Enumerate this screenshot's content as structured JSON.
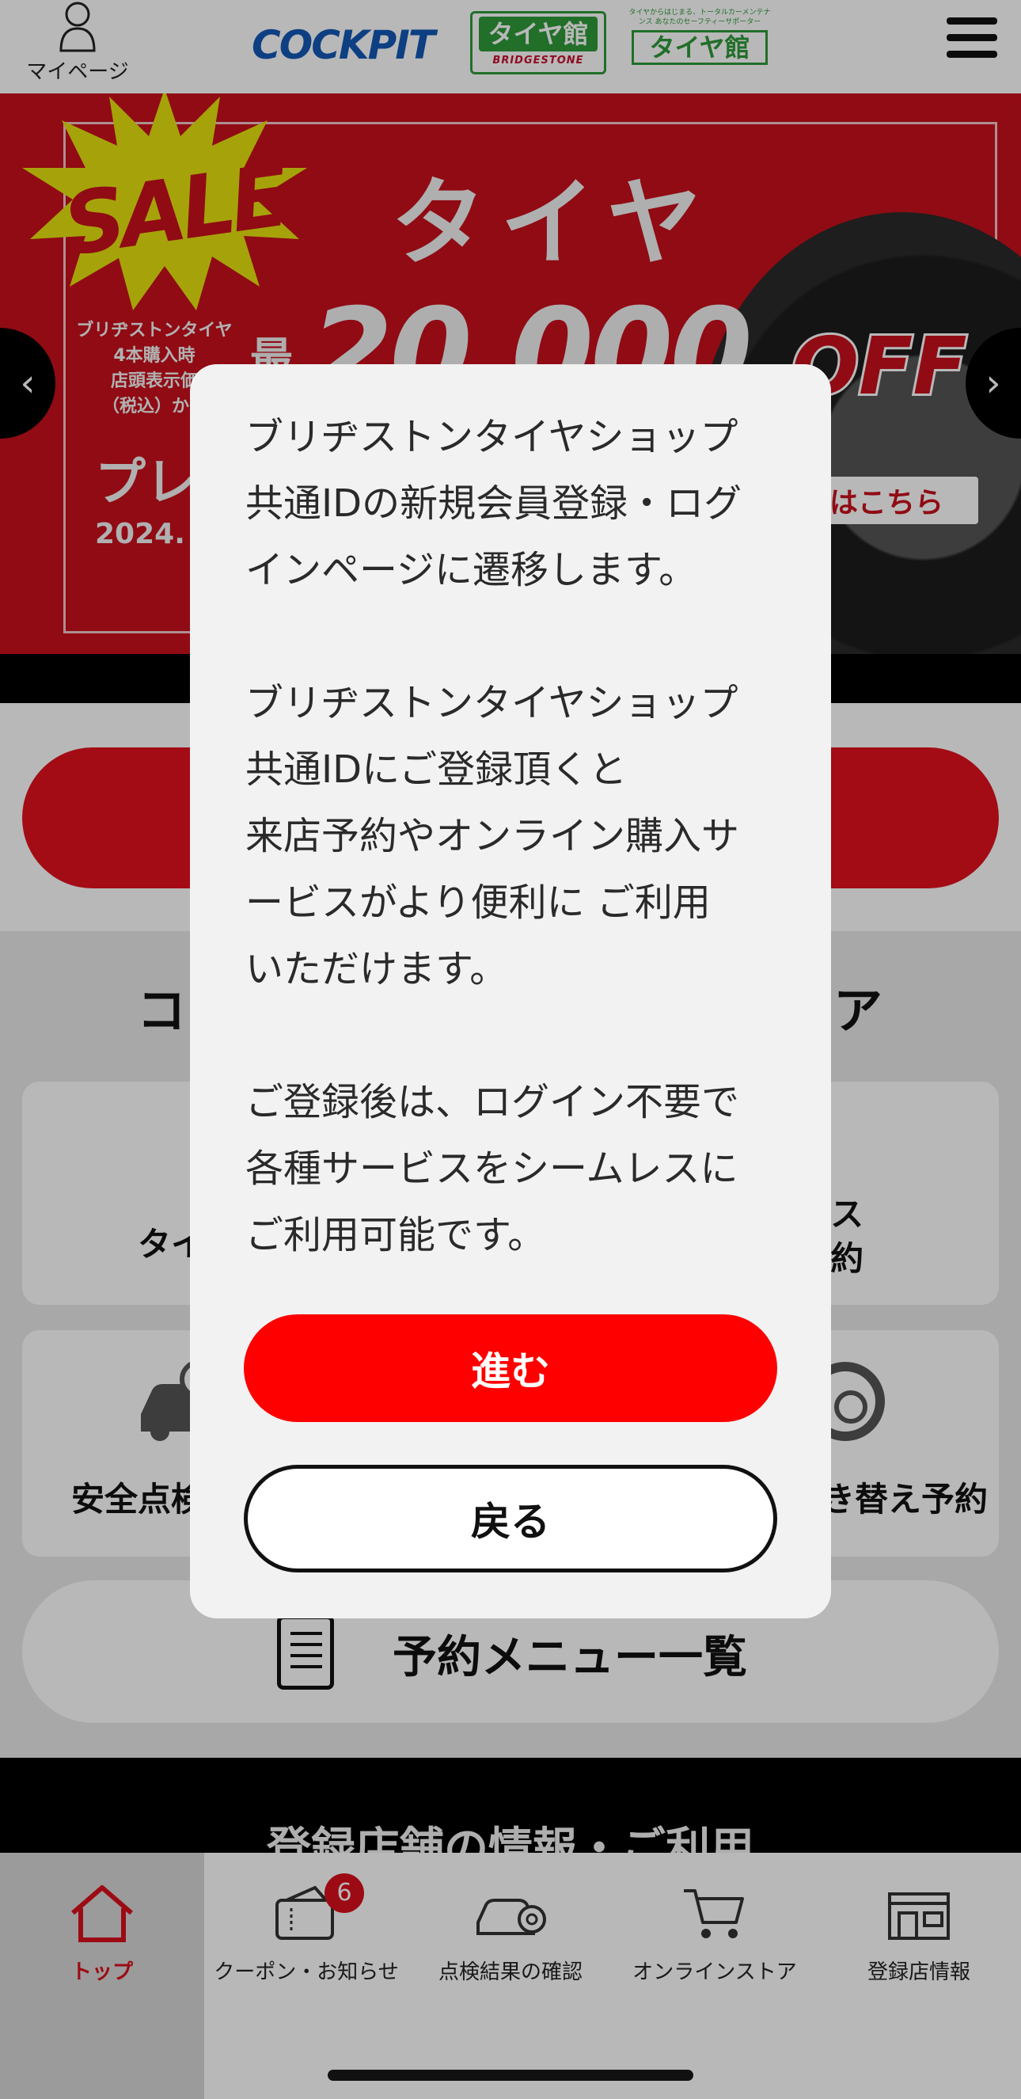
{
  "header": {
    "mypage_label": "マイページ",
    "logo_cockpit": "COCKPIT",
    "logo_tire1_main": "タイヤ館",
    "logo_tire1_brand": "BRIDGESTONE",
    "logo_tire2_small": "タイヤからはじまる、トータルカーメンテナンス あなたのセーフティーサポーター",
    "logo_tire2_main": "タイヤ館"
  },
  "banner": {
    "sale": "SALE",
    "title": "タイヤ",
    "sub_lines": [
      "ブリヂストンタイヤ",
      "4本購入時",
      "店頭表示価",
      "（税込）から"
    ],
    "saki": "最",
    "amount": "20,000",
    "off": "OFF",
    "pre": "プレ",
    "date": "2024.",
    "link": "はこちら"
  },
  "page": {
    "section_title": "コクピ",
    "section_title_right": "ストア",
    "card1_label": "タイ",
    "card2_label_line1": "ンス",
    "card2_label_line2": "約",
    "card3_label": "安全点検",
    "card4_label": "き替え予約",
    "menu_label": "予約メニュー一覧",
    "store_title": "登録店舗の情報・ご利用"
  },
  "modal": {
    "paragraph1": [
      "ブリヂストンタイヤショップ",
      "共通IDの新規会員登録・ログ",
      "インページに遷移します。"
    ],
    "paragraph2": [
      "ブリヂストンタイヤショップ",
      "共通IDにご登録頂くと",
      "来店予約やオンライン購入サ",
      "ービスがより便利に ご利用",
      "いただけます。"
    ],
    "paragraph3": [
      "ご登録後は、ログイン不要で",
      "各種サービスをシームレスに",
      "ご利用可能です。"
    ],
    "proceed_label": "進む",
    "back_label": "戻る"
  },
  "bottom_nav": {
    "items": [
      {
        "label": "トップ",
        "icon": "home-icon",
        "active": true
      },
      {
        "label": "クーポン・お知らせ",
        "icon": "coupon-icon",
        "badge": "6"
      },
      {
        "label": "点検結果の確認",
        "icon": "car-check-icon"
      },
      {
        "label": "オンラインストア",
        "icon": "cart-icon"
      },
      {
        "label": "登録店情報",
        "icon": "store-icon"
      }
    ]
  },
  "colors": {
    "brand_red": "#e2111c",
    "proceed_red": "#ff0000",
    "active_nav": "#d8101c",
    "cockpit_blue": "#1258b5",
    "tirekan_green": "#2f9a3a"
  }
}
